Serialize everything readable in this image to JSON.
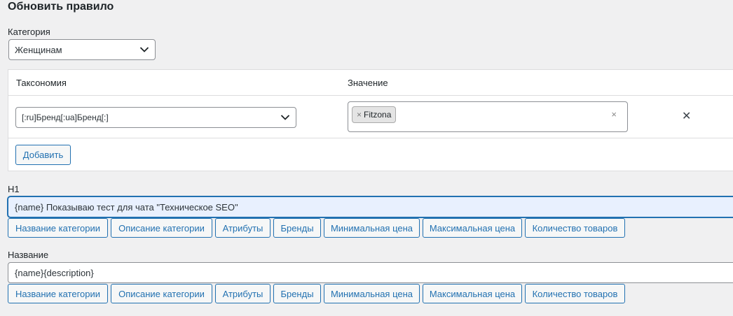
{
  "page": {
    "title": "Обновить правило"
  },
  "category": {
    "label": "Категория",
    "value": "Женщинам"
  },
  "taxonomy_table": {
    "col_taxonomy": "Таксономия",
    "col_value": "Значение",
    "taxonomy_value": "[:ru]Бренд[:ua]Бренд[:]",
    "chip_label": "Fitzona",
    "chip_remove": "×",
    "clear": "×",
    "remove_row": "✕",
    "add_label": "Добавить"
  },
  "h1": {
    "label": "H1",
    "value": "{name} Показываю тест для чата \"Техническое SEO\""
  },
  "name_field": {
    "label": "Название",
    "value": "{name}{description}"
  },
  "placeholder_buttons": [
    "Название категории",
    "Описание категории",
    "Атрибуты",
    "Бренды",
    "Минимальная цена",
    "Максимальная цена",
    "Количество товаров"
  ]
}
